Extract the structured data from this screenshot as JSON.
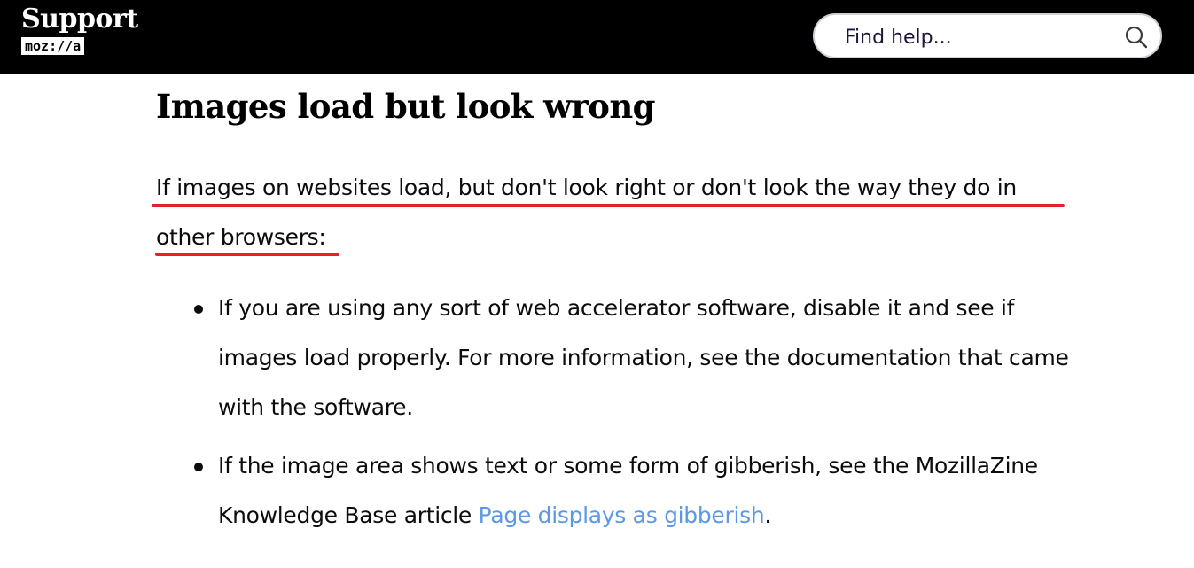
{
  "header": {
    "logo_title": "Support",
    "logo_wordmark": "moz://a",
    "search": {
      "placeholder": "Find help...",
      "icon": "search-icon"
    }
  },
  "article": {
    "heading": "Images load but look wrong",
    "intro": "If images on websites load, but don't look right or don't look the way they do in other browsers:",
    "tips": [
      {
        "text": "If you are using any sort of web accelerator software, disable it and see if images load properly. For more information, see the documentation that came with the software."
      },
      {
        "text_before": "If the image area shows text or some form of gibberish, see the MozillaZine Knowledge Base article ",
        "link_text": "Page displays as gibberish",
        "text_after": "."
      }
    ]
  },
  "colors": {
    "header_bg": "#000000",
    "link": "#5b98e5",
    "annotation_underline": "#e22128"
  }
}
